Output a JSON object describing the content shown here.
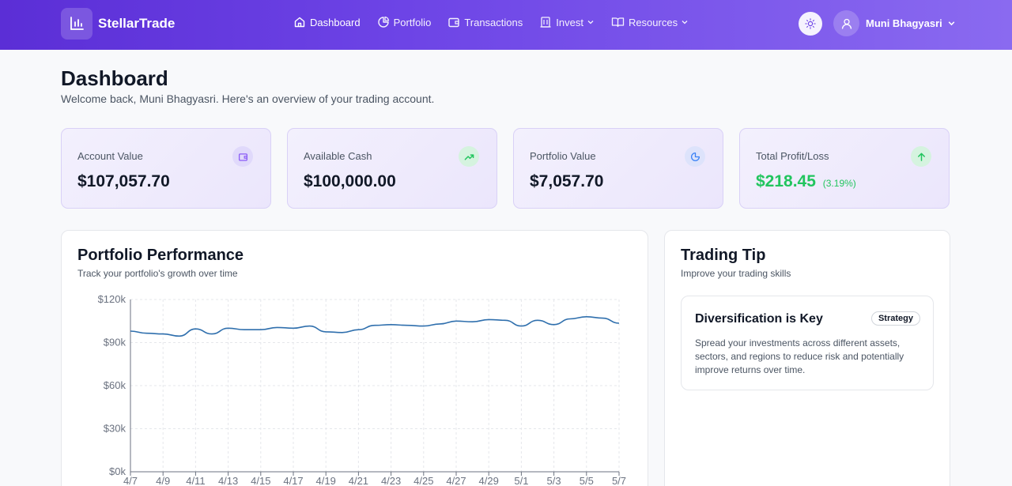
{
  "app": {
    "name": "StellarTrade"
  },
  "nav": {
    "items": [
      {
        "label": "Dashboard",
        "icon": "home-icon"
      },
      {
        "label": "Portfolio",
        "icon": "pie-chart-icon"
      },
      {
        "label": "Transactions",
        "icon": "wallet-icon"
      },
      {
        "label": "Invest",
        "icon": "bank-icon"
      },
      {
        "label": "Resources",
        "icon": "book-icon"
      }
    ]
  },
  "user": {
    "name": "Muni Bhagyasri"
  },
  "header": {
    "title": "Dashboard",
    "subtitle": "Welcome back, Muni Bhagyasri. Here's an overview of your trading account."
  },
  "stats": [
    {
      "label": "Account Value",
      "value": "$107,057.70",
      "icon": "wallet-icon",
      "color": "#8b5cf6"
    },
    {
      "label": "Available Cash",
      "value": "$100,000.00",
      "icon": "trending-up-icon",
      "color": "#22c55e"
    },
    {
      "label": "Portfolio Value",
      "value": "$7,057.70",
      "icon": "pie-chart-icon",
      "color": "#3b82f6"
    },
    {
      "label": "Total Profit/Loss",
      "value": "$218.45",
      "change": "(3.19%)",
      "icon": "arrow-up-icon",
      "color": "#22c55e"
    }
  ],
  "performance": {
    "title": "Portfolio Performance",
    "subtitle": "Track your portfolio's growth over time"
  },
  "chart_data": {
    "type": "line",
    "x_ticks": [
      "4/7",
      "4/9",
      "4/11",
      "4/13",
      "4/15",
      "4/17",
      "4/19",
      "4/21",
      "4/23",
      "4/25",
      "4/27",
      "4/29",
      "5/1",
      "5/3",
      "5/5",
      "5/7"
    ],
    "y_ticks": [
      "$0k",
      "$30k",
      "$60k",
      "$90k",
      "$120k"
    ],
    "ylim": [
      0,
      120000
    ],
    "grid": true,
    "line_color": "#2f6fad",
    "series": [
      {
        "values": [
          98000,
          96500,
          96000,
          94500,
          99500,
          96000,
          100000,
          99000,
          99000,
          100500,
          100000,
          101500,
          97500,
          97000,
          99000,
          102000,
          102500,
          102000,
          101500,
          103000,
          105000,
          104500,
          106000,
          105500,
          101500,
          105500,
          102500,
          106500,
          108000,
          107000,
          103500
        ]
      }
    ]
  },
  "tip": {
    "title": "Trading Tip",
    "subtitle": "Improve your trading skills",
    "card_title": "Diversification is Key",
    "badge": "Strategy",
    "text": "Spread your investments across different assets, sectors, and regions to reduce risk and potentially improve returns over time."
  }
}
